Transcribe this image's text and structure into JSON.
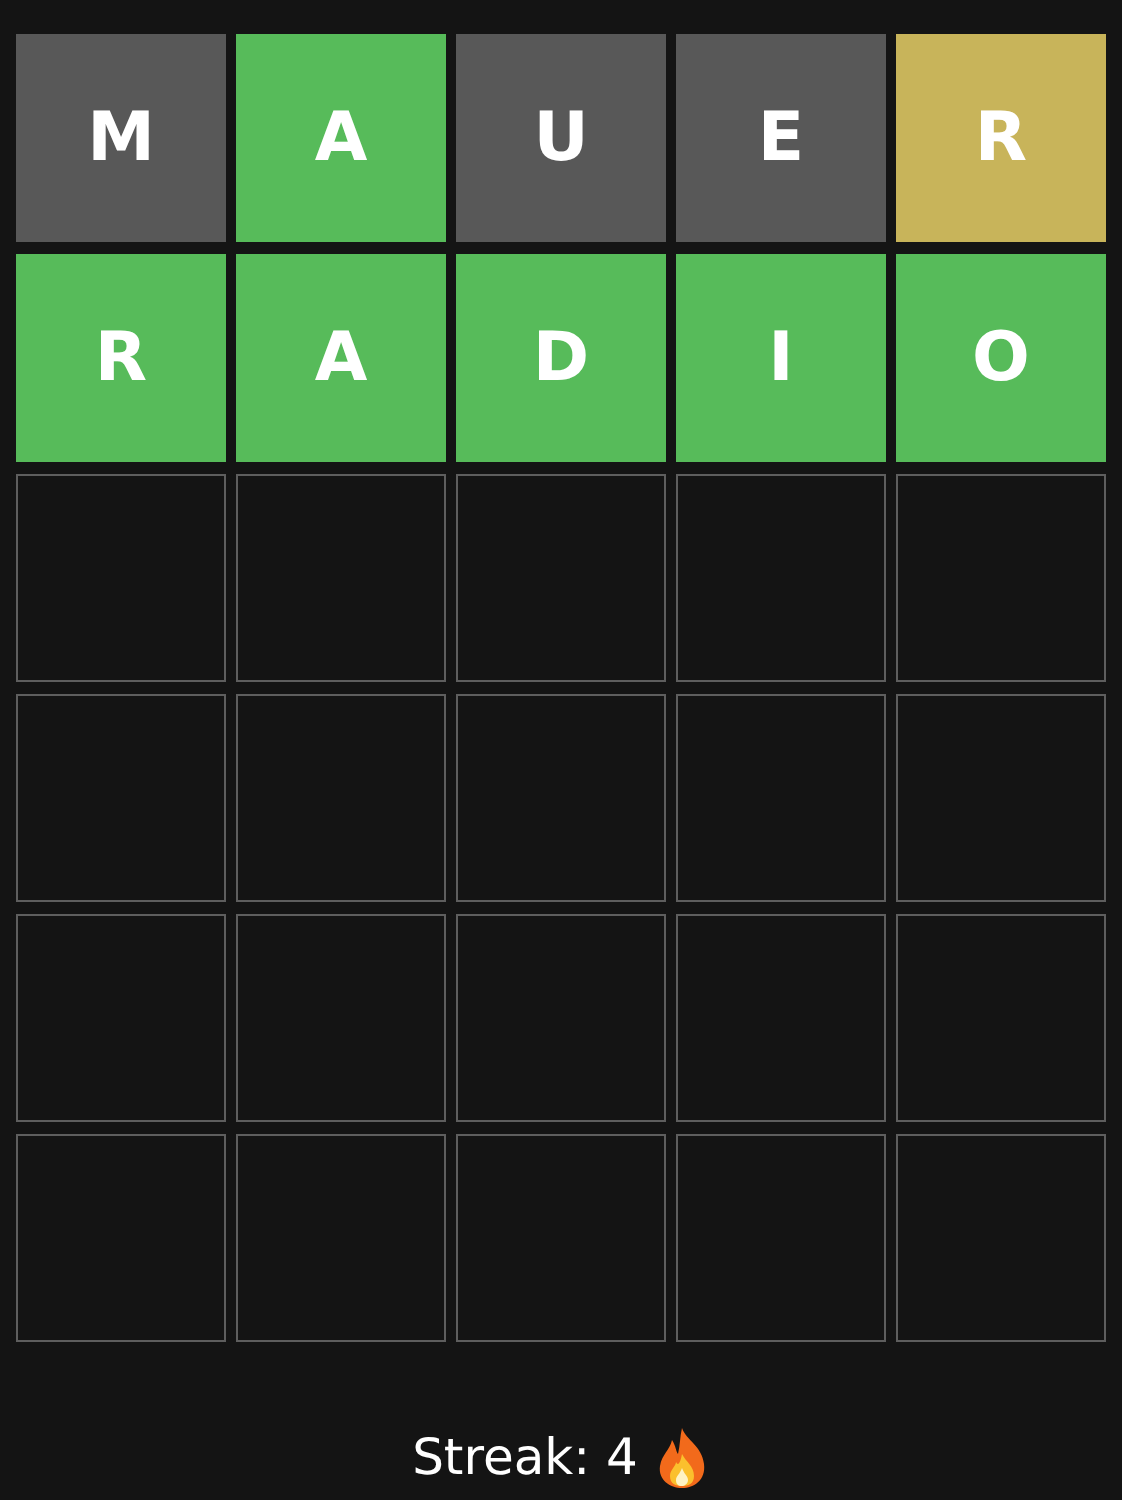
{
  "board": {
    "rows": [
      {
        "tiles": [
          {
            "letter": "M",
            "kind": "absent"
          },
          {
            "letter": "A",
            "kind": "correct"
          },
          {
            "letter": "U",
            "kind": "absent"
          },
          {
            "letter": "E",
            "kind": "absent"
          },
          {
            "letter": "R",
            "kind": "present"
          }
        ]
      },
      {
        "tiles": [
          {
            "letter": "R",
            "kind": "correct"
          },
          {
            "letter": "A",
            "kind": "correct"
          },
          {
            "letter": "D",
            "kind": "correct"
          },
          {
            "letter": "I",
            "kind": "correct"
          },
          {
            "letter": "O",
            "kind": "correct"
          }
        ]
      },
      {
        "tiles": [
          {
            "kind": "empty"
          },
          {
            "kind": "empty"
          },
          {
            "kind": "empty"
          },
          {
            "kind": "empty"
          },
          {
            "kind": "empty"
          }
        ]
      },
      {
        "tiles": [
          {
            "kind": "empty"
          },
          {
            "kind": "empty"
          },
          {
            "kind": "empty"
          },
          {
            "kind": "empty"
          },
          {
            "kind": "empty"
          }
        ]
      },
      {
        "tiles": [
          {
            "kind": "empty"
          },
          {
            "kind": "empty"
          },
          {
            "kind": "empty"
          },
          {
            "kind": "empty"
          },
          {
            "kind": "empty"
          }
        ]
      },
      {
        "tiles": [
          {
            "kind": "empty"
          },
          {
            "kind": "empty"
          },
          {
            "kind": "empty"
          },
          {
            "kind": "empty"
          },
          {
            "kind": "empty"
          }
        ]
      }
    ]
  },
  "streak": {
    "label": "Streak: 4"
  }
}
